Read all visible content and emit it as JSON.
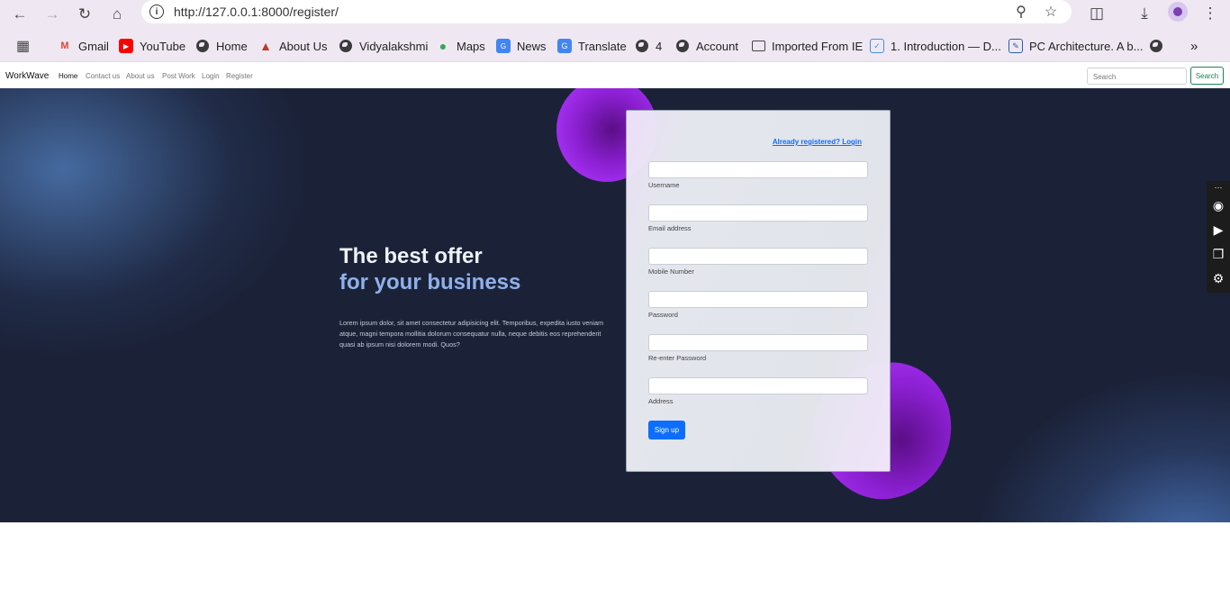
{
  "browser": {
    "url": "http://127.0.0.1:8000/register/",
    "bookmarks": [
      {
        "label": "Gmail",
        "icon": "gmail-icon"
      },
      {
        "label": "YouTube",
        "icon": "youtube-icon"
      },
      {
        "label": "Home",
        "icon": "globe-icon"
      },
      {
        "label": "About Us",
        "icon": "flame-icon"
      },
      {
        "label": "Vidyalakshmi",
        "icon": "globe-icon"
      },
      {
        "label": "Maps",
        "icon": "maps-pin-icon"
      },
      {
        "label": "News",
        "icon": "news-icon"
      },
      {
        "label": "Translate",
        "icon": "translate-icon"
      },
      {
        "label": "4",
        "icon": "globe-icon"
      },
      {
        "label": "Account",
        "icon": "globe-icon"
      },
      {
        "label": "Imported From IE",
        "icon": "folder-icon"
      },
      {
        "label": "1. Introduction — D...",
        "icon": "doc-icon"
      },
      {
        "label": "PC Architecture. A b...",
        "icon": "doc-icon"
      }
    ]
  },
  "site": {
    "brand": "WorkWave",
    "nav": [
      "Home",
      "Contact us",
      "About us",
      "Post Work",
      "Login",
      "Register"
    ],
    "search_placeholder": "Search",
    "search_button": "Search"
  },
  "hero": {
    "headline_line1": "The best offer",
    "headline_line2": "for your business",
    "body": "Lorem ipsum dolor, sit amet consectetur adipisicing elit. Temporibus, expedita iusto veniam atque, magni tempora mollitia dolorum consequatur nulla, neque debitis eos reprehenderit quasi ab ipsum nisi dolorem modi. Quos?"
  },
  "form": {
    "login_link": "Already registered? Login",
    "fields": [
      "Username",
      "Email address",
      "Mobile Number",
      "Password",
      "Re-enter Password",
      "Address"
    ],
    "submit": "Sign up"
  },
  "colors": {
    "accent": "#0d6efd",
    "success": "#198754",
    "hero_bg": "#1b2238",
    "blob": "#8a1fd0"
  }
}
